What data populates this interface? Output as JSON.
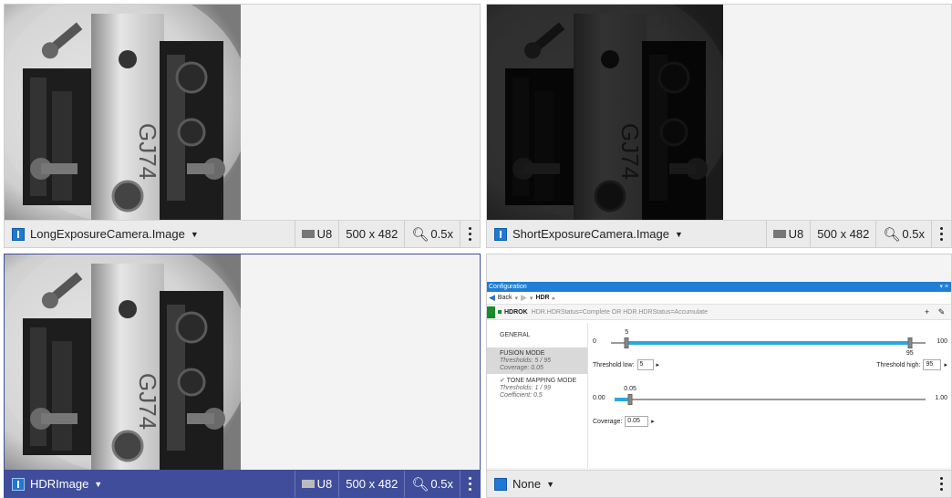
{
  "panes": {
    "top_left": {
      "label": "LongExposureCamera.Image",
      "format": "U8",
      "size": "500 x 482",
      "zoom": "0.5x"
    },
    "top_right": {
      "label": "ShortExposureCamera.Image",
      "format": "U8",
      "size": "500 x 482",
      "zoom": "0.5x"
    },
    "bottom_left": {
      "label": "HDRImage",
      "format": "U8",
      "size": "500 x 482",
      "zoom": "0.5x"
    },
    "bottom_right": {
      "label": "None"
    }
  },
  "config": {
    "title": "Configuration",
    "nav": {
      "back": "Back",
      "crumb": "HDR"
    },
    "tool": {
      "name": "HDROK",
      "expression": "HDR.HDRStatus=Complete OR HDR.HDRStatus=Accumulate",
      "add": "+",
      "edit": "✎"
    },
    "menu": [
      {
        "title": "GENERAL",
        "lines": []
      },
      {
        "title": "FUSION MODE",
        "lines": [
          "Thresholds: 5 / 95",
          "Coverage: 0.05"
        ]
      },
      {
        "title": "✓ TONE MAPPING MODE",
        "lines": [
          "Thresholds: 1 / 99",
          "Coefficient: 0.5"
        ]
      }
    ],
    "threshold_slider": {
      "min": "0",
      "max": "100",
      "low": 5,
      "high": 95,
      "low_label": "5",
      "high_label": "95"
    },
    "threshold_low_label": "Threshold low:",
    "threshold_low_value": "5",
    "threshold_high_label": "Threshold high:",
    "threshold_high_value": "95",
    "coverage_slider": {
      "min": "0.00",
      "max": "1.00",
      "value": 0.05,
      "value_label": "0.05"
    },
    "coverage_label": "Coverage:",
    "coverage_value": "0.05"
  }
}
